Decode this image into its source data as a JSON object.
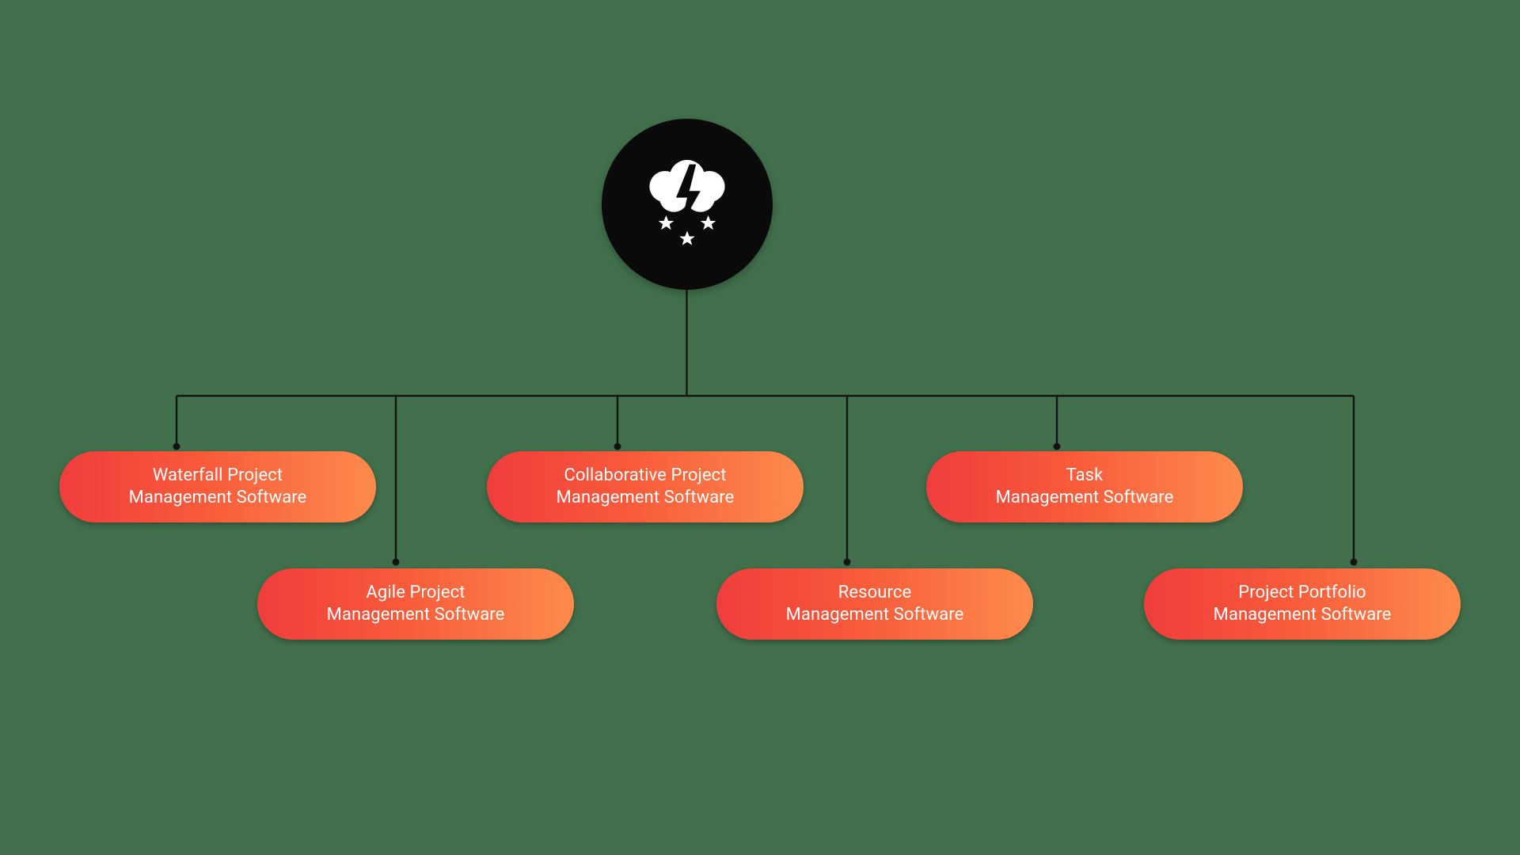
{
  "diagram": {
    "root_icon": "brainstorm-icon",
    "nodes": [
      {
        "line1": "Waterfall Project",
        "line2": "Management Software"
      },
      {
        "line1": "Agile Project",
        "line2": "Management Software"
      },
      {
        "line1": "Collaborative Project",
        "line2": "Management Software"
      },
      {
        "line1": "Resource",
        "line2": "Management Software"
      },
      {
        "line1": "Task",
        "line2": "Management Software"
      },
      {
        "line1": "Project Portfolio",
        "line2": "Management Software"
      }
    ]
  },
  "colors": {
    "background": "#42704c",
    "root_circle": "#0a0a0a",
    "pill_gradient_from": "#f03d3d",
    "pill_gradient_to": "#fd8b4d",
    "connector": "#141414"
  }
}
